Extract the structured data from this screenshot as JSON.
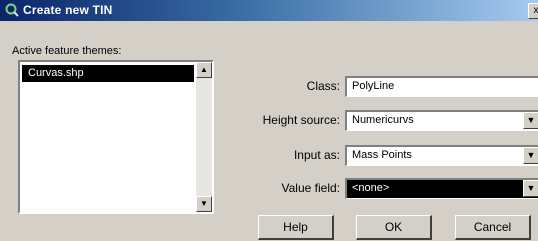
{
  "window": {
    "title": "Create new TIN",
    "close_glyph": "x"
  },
  "themes": {
    "label": "Active feature themes:",
    "items": [
      "Curvas.shp"
    ],
    "scroll_up": "▲",
    "scroll_down": "▼"
  },
  "form": {
    "class_label": "Class:",
    "class_value": "PolyLine",
    "height_source_label": "Height source:",
    "height_source_value": "Numericurvs",
    "input_as_label": "Input as:",
    "input_as_value": "Mass Points",
    "value_field_label": "Value field:",
    "value_field_value": "<none>",
    "dropdown_glyph": "▼"
  },
  "buttons": {
    "help": "Help",
    "ok": "OK",
    "cancel": "Cancel"
  },
  "colors": {
    "titlebar_start": "#0a246a",
    "titlebar_end": "#a6caf0",
    "dialog_bg": "#d4d0c8",
    "selection": "#000000"
  }
}
